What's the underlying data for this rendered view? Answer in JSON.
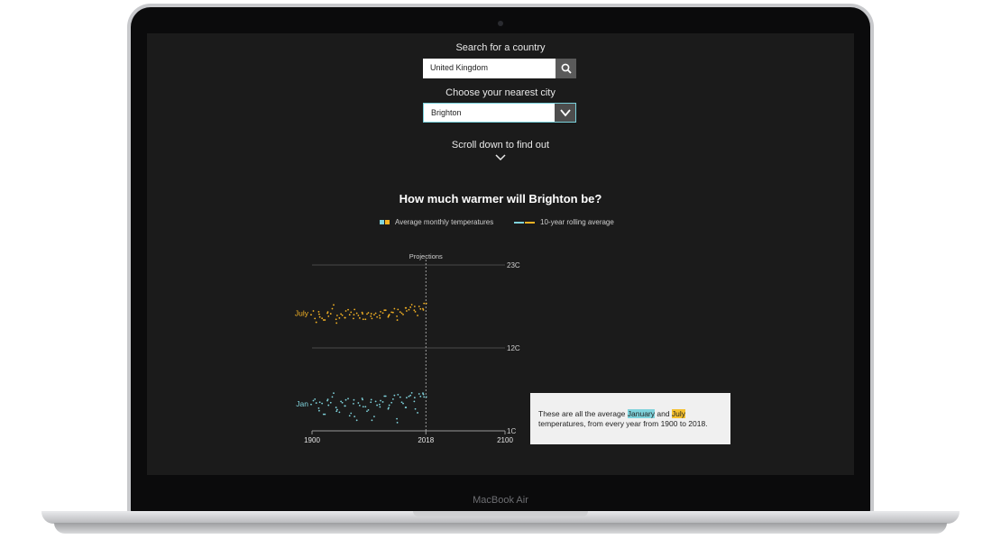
{
  "device": {
    "brand": "MacBook Air"
  },
  "search": {
    "label": "Search for a country",
    "value": "United Kingdom",
    "icon": "search-icon"
  },
  "city": {
    "label": "Choose your nearest city",
    "value": "Brighton",
    "icon": "chevron-down-icon"
  },
  "scroll_hint": {
    "label": "Scroll down to find out",
    "icon": "chevron-down-icon"
  },
  "legend": {
    "avg": "Average monthly temperatures",
    "rolling": "10-year rolling average"
  },
  "tooltip": {
    "before": "These are all the average ",
    "january": "January",
    "and": " and ",
    "july": "July",
    "after": " temperatures, from every year from 1900 to 2018."
  },
  "colors": {
    "january": "#7fd3dc",
    "july": "#f5b324",
    "background": "#1b1b1b"
  },
  "chart_data": {
    "type": "scatter",
    "title": "How much warmer will Brighton be?",
    "projection_label": "Projections",
    "x_ticks": [
      "1900",
      "2018",
      "2100"
    ],
    "y_ticks": [
      "23C",
      "12C",
      "1C"
    ],
    "xlim": [
      1900,
      2100
    ],
    "ylim": [
      1,
      23
    ],
    "series": [
      {
        "name": "July",
        "values_note": "",
        "x": [
          1900,
          1903,
          1906,
          1909,
          1912,
          1915,
          1918,
          1921,
          1924,
          1927,
          1930,
          1933,
          1936,
          1939,
          1942,
          1945,
          1948,
          1951,
          1954,
          1957,
          1960,
          1963,
          1966,
          1969,
          1972,
          1975,
          1978,
          1981,
          1984,
          1987,
          1990,
          1993,
          1996,
          1999,
          2002,
          2005,
          2008,
          2011,
          2014,
          2017
        ],
        "values": [
          16.4,
          15.9,
          16.8,
          16.1,
          15.7,
          16.6,
          16.2,
          17.2,
          15.8,
          16.3,
          16.5,
          16.0,
          16.9,
          16.4,
          15.9,
          17.1,
          16.3,
          16.7,
          15.8,
          16.5,
          16.2,
          15.9,
          16.6,
          16.3,
          16.8,
          17.0,
          16.1,
          16.4,
          16.7,
          16.2,
          17.1,
          16.6,
          17.3,
          16.9,
          17.4,
          17.0,
          16.8,
          17.5,
          17.2,
          17.9
        ]
      },
      {
        "name": "Jan",
        "x": [
          1900,
          1903,
          1906,
          1909,
          1912,
          1915,
          1918,
          1921,
          1924,
          1927,
          1930,
          1933,
          1936,
          1939,
          1942,
          1945,
          1948,
          1951,
          1954,
          1957,
          1960,
          1963,
          1966,
          1969,
          1972,
          1975,
          1978,
          1981,
          1984,
          1987,
          1990,
          1993,
          1996,
          1999,
          2002,
          2005,
          2008,
          2011,
          2014,
          2017
        ],
        "values": [
          4.5,
          5.2,
          4.0,
          4.8,
          3.2,
          5.0,
          4.4,
          5.5,
          4.1,
          3.8,
          4.9,
          4.3,
          5.1,
          3.0,
          4.6,
          2.9,
          4.7,
          5.3,
          4.2,
          3.6,
          4.8,
          2.4,
          4.9,
          4.5,
          5.0,
          5.6,
          3.9,
          4.4,
          5.2,
          2.6,
          5.8,
          4.8,
          4.1,
          5.4,
          5.7,
          4.9,
          3.9,
          5.9,
          6.0,
          5.5
        ]
      }
    ]
  }
}
